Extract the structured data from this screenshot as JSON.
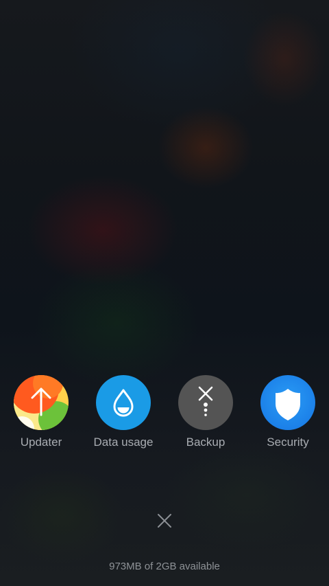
{
  "recent_apps": [
    {
      "label": "Updater",
      "icon": "updater-arrow-icon"
    },
    {
      "label": "Data usage",
      "icon": "water-drop-icon"
    },
    {
      "label": "Backup",
      "icon": "backup-x-dots-icon"
    },
    {
      "label": "Security",
      "icon": "shield-icon"
    }
  ],
  "close_button": {
    "icon": "close-icon"
  },
  "memory_status": "973MB of 2GB available",
  "colors": {
    "data_usage_bg": "#1a9be6",
    "backup_bg": "#545454",
    "security_bg": "#1e8cf0",
    "label_text": "#a9adb2"
  }
}
